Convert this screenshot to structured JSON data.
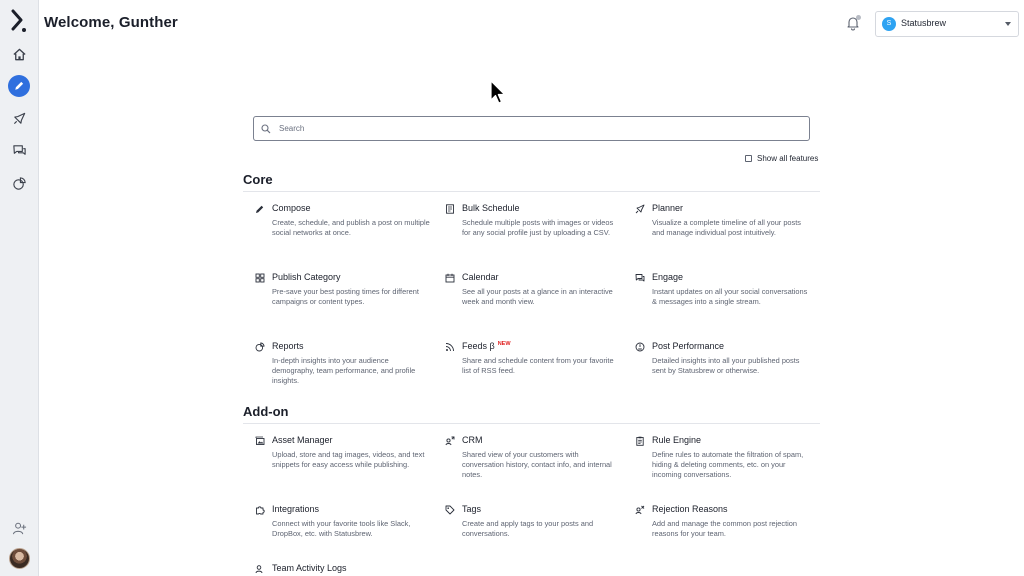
{
  "header": {
    "title": "Welcome, Gunther",
    "account": {
      "initial": "S",
      "name": "Statusbrew"
    }
  },
  "sidebar": {
    "items": [
      {
        "name": "home",
        "icon": "home-icon"
      },
      {
        "name": "compose",
        "icon": "pencil-icon",
        "active": true
      },
      {
        "name": "publish",
        "icon": "rocket-icon"
      },
      {
        "name": "engage",
        "icon": "chat-icon"
      },
      {
        "name": "reports",
        "icon": "pie-chart-icon"
      },
      {
        "name": "invite-user",
        "icon": "add-user-icon"
      }
    ]
  },
  "search": {
    "placeholder": "Search"
  },
  "show_all_features": "Show all features",
  "sections": {
    "core": {
      "title": "Core",
      "items": [
        {
          "name": "Compose",
          "desc": "Create, schedule, and publish a post on multiple social networks at once.",
          "icon": "pencil-icon"
        },
        {
          "name": "Bulk Schedule",
          "desc": "Schedule multiple posts with images or videos for any social profile just by uploading a CSV.",
          "icon": "document-icon"
        },
        {
          "name": "Planner",
          "desc": "Visualize a complete timeline of all your posts and manage individual post intuitively.",
          "icon": "rocket-icon"
        },
        {
          "name": "Publish Category",
          "desc": "Pre-save your best posting times for different campaigns or content types.",
          "icon": "grid-icon"
        },
        {
          "name": "Calendar",
          "desc": "See all your posts at a glance in an interactive week and month view.",
          "icon": "calendar-icon"
        },
        {
          "name": "Engage",
          "desc": "Instant updates on all your social conversations & messages into a single stream.",
          "icon": "chat-icon"
        },
        {
          "name": "Reports",
          "desc": "In-depth insights into your audience demography, team performance, and profile insights.",
          "icon": "pie-chart-icon"
        },
        {
          "name": "Feeds β",
          "badge": "NEW",
          "desc": "Share and schedule content from your favorite list of RSS feed.",
          "icon": "rss-icon"
        },
        {
          "name": "Post Performance",
          "desc": "Detailed insights into all your published posts sent by Statusbrew or otherwise.",
          "icon": "gauge-icon"
        }
      ]
    },
    "addon": {
      "title": "Add-on",
      "items": [
        {
          "name": "Asset Manager",
          "desc": "Upload, store and tag images, videos, and text snippets for easy access while publishing.",
          "icon": "image-icon"
        },
        {
          "name": "CRM",
          "desc": "Shared view of your customers with conversation history, contact info, and internal notes.",
          "icon": "crm-icon"
        },
        {
          "name": "Rule Engine",
          "desc": "Define rules to automate the filtration of spam, hiding & deleting comments, etc. on your incoming conversations.",
          "icon": "clipboard-icon"
        },
        {
          "name": "Integrations",
          "desc": "Connect with your favorite tools like Slack, DropBox, etc. with Statusbrew.",
          "icon": "puzzle-icon"
        },
        {
          "name": "Tags",
          "desc": "Create and apply tags to your posts and conversations.",
          "icon": "tag-icon"
        },
        {
          "name": "Rejection Reasons",
          "desc": "Add and manage the common post rejection reasons for your team.",
          "icon": "reject-user-icon"
        },
        {
          "name": "Team Activity Logs",
          "desc": "",
          "icon": "activity-icon"
        }
      ]
    }
  }
}
